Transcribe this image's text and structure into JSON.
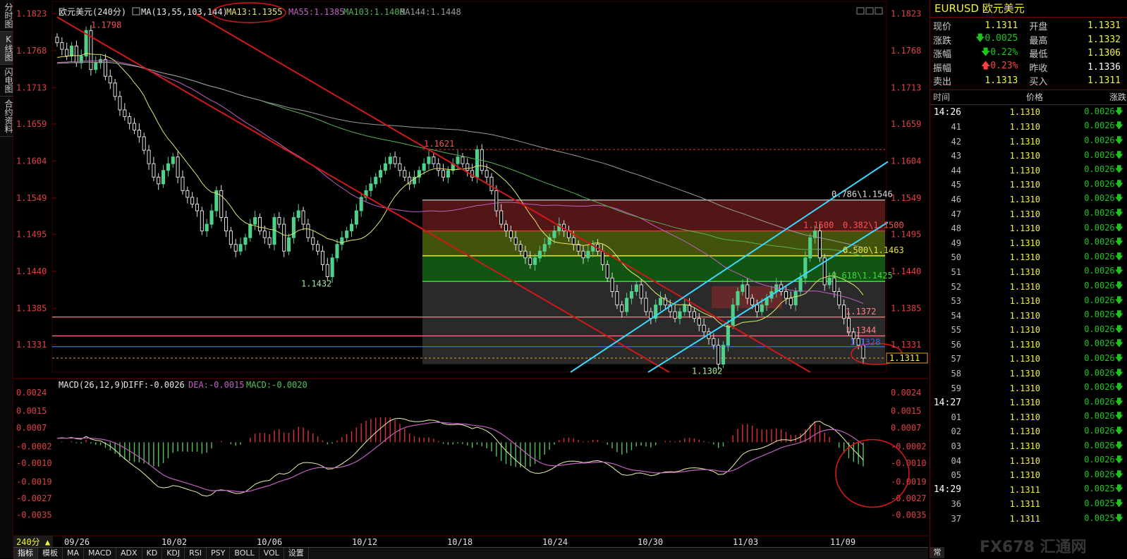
{
  "left_tabs": [
    "分时图",
    "K线图",
    "闪电图",
    "合约资料"
  ],
  "header": {
    "symbol_period": "欧元美元(240分)",
    "ma_label": "MA(13,55,103,144)",
    "ma13": "MA13:1.1355",
    "ma55": "MA55:1.1385",
    "ma103": "MA103:1.1408",
    "ma144": "MA144:1.1448"
  },
  "macd_header": {
    "label": "MACD(26,12,9)",
    "diff": "DIFF:-0.0026",
    "dea": "DEA:-0.0015",
    "macd": "MACD:-0.0020"
  },
  "period_button": "240分 ▲",
  "x_labels": [
    "09/26",
    "10/02",
    "10/06",
    "10/12",
    "10/18",
    "10/24",
    "10/30",
    "11/03",
    "11/09"
  ],
  "price_ticks": [
    "1.1823",
    "1.1768",
    "1.1713",
    "1.1659",
    "1.1604",
    "1.1549",
    "1.1495",
    "1.1440",
    "1.1385",
    "1.1331"
  ],
  "macd_ticks": [
    "0.0024",
    "0.0015",
    "0.0007",
    "-0.0002",
    "-0.0010",
    "-0.0019",
    "-0.0027",
    "-0.0035"
  ],
  "annotations": {
    "high": "1.1798",
    "low1": "1.1432",
    "peak2": "1.1621",
    "low2": "1.1302",
    "lvl1372": "1.1372",
    "lvl1344": "1.1344",
    "lvl1328": "1.1328",
    "current": "1.1311",
    "fib_0786": "0.786\\1.1546",
    "fib_0382_prefix": "1.1500",
    "fib_0382": "0.382\\1.1500",
    "fib_0500": "0.500\\1.1463",
    "fib_0618": "0.618\\1.1425"
  },
  "colors": {
    "up": "#4fd18a",
    "down": "#e0e0e0",
    "ma13": "#e6e66a",
    "ma55": "#c060c0",
    "ma103": "#9a9a9a",
    "ma144": "#58b058",
    "channel_red": "#d01818",
    "channel_cyan": "#3ad8ff",
    "macd_pos": "#e03030",
    "macd_neg": "#58c058"
  },
  "quote": {
    "title": "EURUSD 欧元美元",
    "rows": [
      {
        "l1": "现价",
        "v1": "1.1311",
        "c1": "#f3f33a",
        "l2": "开盘",
        "v2": "1.1331",
        "c2": "#f3f33a"
      },
      {
        "l1": "涨跌",
        "v1": "0.0025",
        "c1": "#1fc41f",
        "arrow1": "down",
        "l2": "最高",
        "v2": "1.1332",
        "c2": "#f3f33a"
      },
      {
        "l1": "涨幅",
        "v1": "0.22%",
        "c1": "#1fc41f",
        "arrow1": "down",
        "l2": "最低",
        "v2": "1.1306",
        "c2": "#f3f33a"
      },
      {
        "l1": "振幅",
        "v1": "0.23%",
        "c1": "#ff4040",
        "arrow1": "up",
        "l2": "昨收",
        "v2": "1.1336",
        "c2": "#ffffff"
      },
      {
        "l1": "卖出",
        "v1": "1.1313",
        "c1": "#f3f33a",
        "l2": "买入",
        "v2": "1.1311",
        "c2": "#f3f33a"
      }
    ]
  },
  "ticks_header": {
    "time": "时间",
    "price": "价格",
    "change": "涨跌"
  },
  "ticks": [
    {
      "time": "14:26",
      "price": "1.1310",
      "chg": "0.0026"
    },
    {
      "time": "41",
      "price": "1.1310",
      "chg": "0.0026"
    },
    {
      "time": "42",
      "price": "1.1310",
      "chg": "0.0026"
    },
    {
      "time": "43",
      "price": "1.1310",
      "chg": "0.0026"
    },
    {
      "time": "44",
      "price": "1.1310",
      "chg": "0.0026"
    },
    {
      "time": "45",
      "price": "1.1310",
      "chg": "0.0026"
    },
    {
      "time": "46",
      "price": "1.1310",
      "chg": "0.0026"
    },
    {
      "time": "47",
      "price": "1.1310",
      "chg": "0.0026"
    },
    {
      "time": "48",
      "price": "1.1310",
      "chg": "0.0026"
    },
    {
      "time": "49",
      "price": "1.1310",
      "chg": "0.0026"
    },
    {
      "time": "50",
      "price": "1.1310",
      "chg": "0.0026"
    },
    {
      "time": "51",
      "price": "1.1310",
      "chg": "0.0026"
    },
    {
      "time": "52",
      "price": "1.1310",
      "chg": "0.0026"
    },
    {
      "time": "53",
      "price": "1.1310",
      "chg": "0.0026"
    },
    {
      "time": "54",
      "price": "1.1310",
      "chg": "0.0026"
    },
    {
      "time": "55",
      "price": "1.1310",
      "chg": "0.0026"
    },
    {
      "time": "56",
      "price": "1.1310",
      "chg": "0.0026"
    },
    {
      "time": "57",
      "price": "1.1310",
      "chg": "0.0026"
    },
    {
      "time": "58",
      "price": "1.1310",
      "chg": "0.0026"
    },
    {
      "time": "59",
      "price": "1.1310",
      "chg": "0.0026"
    },
    {
      "time": "14:27",
      "price": "1.1310",
      "chg": "0.0026"
    },
    {
      "time": "01",
      "price": "1.1310",
      "chg": "0.0026"
    },
    {
      "time": "02",
      "price": "1.1310",
      "chg": "0.0026"
    },
    {
      "time": "03",
      "price": "1.1310",
      "chg": "0.0026"
    },
    {
      "time": "04",
      "price": "1.1310",
      "chg": "0.0026"
    },
    {
      "time": "05",
      "price": "1.1310",
      "chg": "0.0026"
    },
    {
      "time": "14:29",
      "price": "1.1311",
      "chg": "0.0025"
    },
    {
      "time": "36",
      "price": "1.1311",
      "chg": "0.0025"
    },
    {
      "time": "37",
      "price": "1.1311",
      "chg": "0.0025"
    }
  ],
  "bottom_tabs": [
    "指标",
    "模板",
    "MA",
    "MACD",
    "ADX",
    "KD",
    "KDJ",
    "RSI",
    "PSY",
    "BOLL",
    "VOL",
    "设置"
  ],
  "side_bottom_tab": "常",
  "watermark": "FX678 汇通网",
  "chart_data": [
    {
      "type": "candlestick",
      "ylim": [
        1.129,
        1.1835
      ],
      "x_ticks": [
        "09/26",
        "10/02",
        "10/06",
        "10/12",
        "10/18",
        "10/24",
        "10/30",
        "11/03",
        "11/09"
      ],
      "close_approx": [
        1.178,
        1.177,
        1.176,
        1.1775,
        1.175,
        1.176,
        1.1798,
        1.174,
        1.175,
        1.1755,
        1.173,
        1.172,
        1.17,
        1.168,
        1.167,
        1.166,
        1.165,
        1.164,
        1.162,
        1.16,
        1.158,
        1.157,
        1.159,
        1.16,
        1.161,
        1.158,
        1.156,
        1.155,
        1.154,
        1.153,
        1.15,
        1.151,
        1.153,
        1.156,
        1.152,
        1.15,
        1.148,
        1.147,
        1.148,
        1.149,
        1.151,
        1.152,
        1.15,
        1.149,
        1.148,
        1.152,
        1.151,
        1.147,
        1.149,
        1.152,
        1.153,
        1.151,
        1.149,
        1.148,
        1.147,
        1.145,
        1.1432,
        1.146,
        1.148,
        1.149,
        1.15,
        1.151,
        1.153,
        1.155,
        1.156,
        1.157,
        1.158,
        1.159,
        1.16,
        1.161,
        1.16,
        1.159,
        1.158,
        1.157,
        1.158,
        1.159,
        1.16,
        1.161,
        1.16,
        1.159,
        1.158,
        1.159,
        1.16,
        1.161,
        1.16,
        1.159,
        1.158,
        1.1621,
        1.159,
        1.158,
        1.156,
        1.153,
        1.151,
        1.15,
        1.149,
        1.148,
        1.147,
        1.146,
        1.145,
        1.146,
        1.147,
        1.148,
        1.149,
        1.15,
        1.151,
        1.15,
        1.149,
        1.148,
        1.147,
        1.146,
        1.147,
        1.148,
        1.147,
        1.145,
        1.143,
        1.141,
        1.139,
        1.138,
        1.14,
        1.141,
        1.142,
        1.14,
        1.138,
        1.137,
        1.139,
        1.14,
        1.139,
        1.138,
        1.137,
        1.138,
        1.139,
        1.138,
        1.137,
        1.136,
        1.135,
        1.134,
        1.133,
        1.1302,
        1.133,
        1.136,
        1.139,
        1.141,
        1.142,
        1.14,
        1.139,
        1.138,
        1.139,
        1.14,
        1.141,
        1.142,
        1.141,
        1.14,
        1.139,
        1.141,
        1.143,
        1.146,
        1.149,
        1.15,
        1.146,
        1.142,
        1.143,
        1.141,
        1.139,
        1.137,
        1.135,
        1.134,
        1.133,
        1.1311
      ],
      "series": [
        {
          "name": "MA13",
          "value": 1.1355
        },
        {
          "name": "MA55",
          "value": 1.1385
        },
        {
          "name": "MA103",
          "value": 1.1408
        },
        {
          "name": "MA144",
          "value": 1.1448
        }
      ],
      "horizontal_levels": [
        1.1621,
        1.1546,
        1.15,
        1.1463,
        1.1425,
        1.1372,
        1.1344,
        1.1328,
        1.1311
      ],
      "annotated_points": {
        "high": 1.1798,
        "low1": 1.1432,
        "peak2": 1.1621,
        "low2": 1.1302
      }
    },
    {
      "type": "macd",
      "ylim": [
        -0.0041,
        0.0028
      ],
      "series": [
        {
          "name": "DIFF",
          "last": -0.0026
        },
        {
          "name": "DEA",
          "last": -0.0015
        },
        {
          "name": "MACD",
          "last": -0.002
        }
      ]
    }
  ]
}
